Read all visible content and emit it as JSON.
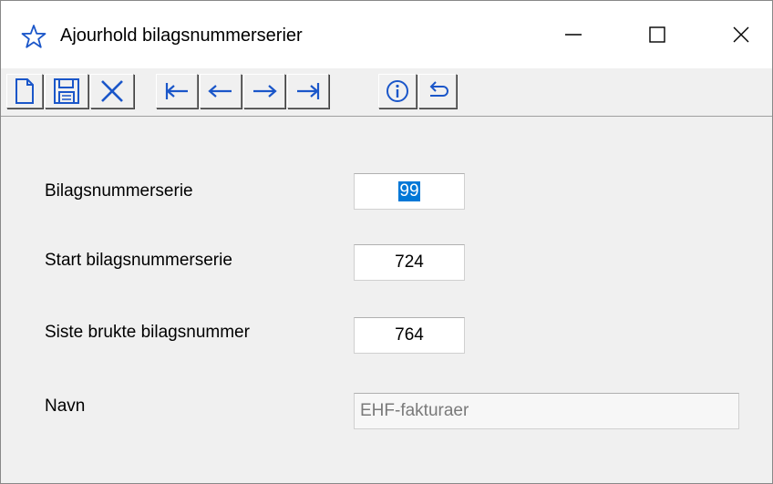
{
  "window": {
    "title": "Ajourhold bilagsnummerserier",
    "icon": "star-outline-icon",
    "controls": [
      "minimize-icon",
      "maximize-icon",
      "close-icon"
    ]
  },
  "toolbar": {
    "buttons": [
      {
        "name": "new-document-icon"
      },
      {
        "name": "save-icon"
      },
      {
        "name": "delete-icon"
      },
      {
        "name": "first-record-icon"
      },
      {
        "name": "previous-record-icon"
      },
      {
        "name": "next-record-icon"
      },
      {
        "name": "last-record-icon"
      },
      {
        "name": "info-icon"
      },
      {
        "name": "undo-icon"
      }
    ]
  },
  "form": {
    "bilagsnummerserie": {
      "label": "Bilagsnummerserie",
      "value": "99",
      "selected": true
    },
    "start": {
      "label": "Start bilagsnummerserie",
      "value": "724"
    },
    "siste": {
      "label": "Siste brukte bilagsnummer",
      "value": "764"
    },
    "navn": {
      "label": "Navn",
      "value": "EHF-fakturaer"
    }
  },
  "colors": {
    "selection": "#0078d7",
    "icon": "#1a56c9",
    "background": "#f0f0f0"
  }
}
